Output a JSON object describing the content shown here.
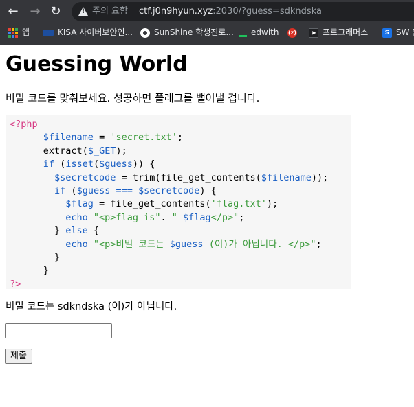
{
  "browser": {
    "security_label": "주의 요함",
    "url_host": "ctf.j0n9hyun.xyz",
    "url_rest": ":2030/?guess=sdkndska",
    "bookmarks": [
      {
        "icon": "apps-grid-icon",
        "label": "앱"
      },
      {
        "icon": "kisa-logo-icon",
        "label": "KISA 사이버보안인..."
      },
      {
        "icon": "sunshine-icon",
        "label": "SunShine 학생진로..."
      },
      {
        "icon": "edwith-icon",
        "label": "edwith"
      },
      {
        "icon": "z-icon",
        "label": ""
      },
      {
        "icon": "programmers-icon",
        "label": "프로그래머스"
      },
      {
        "icon": "sw-icon",
        "label": "SW 단"
      }
    ]
  },
  "page": {
    "title": "Guessing World",
    "description": "비밀 코드를 맞춰보세요. 성공하면 플래그를 뱉어낼 겁니다.",
    "code_lines": [
      {
        "indent": "",
        "parts": [
          {
            "t": "<?php",
            "c": "tag"
          }
        ]
      },
      {
        "indent": "      ",
        "parts": [
          {
            "t": "$filename",
            "c": "var"
          },
          {
            "t": " = ",
            "c": "plain"
          },
          {
            "t": "'secret.txt'",
            "c": "str"
          },
          {
            "t": ";",
            "c": "plain"
          }
        ]
      },
      {
        "indent": "      ",
        "parts": [
          {
            "t": "extract(",
            "c": "plain"
          },
          {
            "t": "$_GET",
            "c": "var"
          },
          {
            "t": ");",
            "c": "plain"
          }
        ]
      },
      {
        "indent": "      ",
        "parts": [
          {
            "t": "if",
            "c": "kw"
          },
          {
            "t": " (",
            "c": "plain"
          },
          {
            "t": "isset",
            "c": "kw"
          },
          {
            "t": "(",
            "c": "plain"
          },
          {
            "t": "$guess",
            "c": "var"
          },
          {
            "t": ")) {",
            "c": "plain"
          }
        ]
      },
      {
        "indent": "        ",
        "parts": [
          {
            "t": "$secretcode",
            "c": "var"
          },
          {
            "t": " = trim(file_get_contents(",
            "c": "plain"
          },
          {
            "t": "$filename",
            "c": "var"
          },
          {
            "t": "));",
            "c": "plain"
          }
        ]
      },
      {
        "indent": "        ",
        "parts": [
          {
            "t": "if",
            "c": "kw"
          },
          {
            "t": " (",
            "c": "plain"
          },
          {
            "t": "$guess",
            "c": "var"
          },
          {
            "t": " === ",
            "c": "kw"
          },
          {
            "t": "$secretcode",
            "c": "var"
          },
          {
            "t": ") {",
            "c": "plain"
          }
        ]
      },
      {
        "indent": "          ",
        "parts": [
          {
            "t": "$flag",
            "c": "var"
          },
          {
            "t": " = file_get_contents(",
            "c": "plain"
          },
          {
            "t": "'flag.txt'",
            "c": "str"
          },
          {
            "t": ");",
            "c": "plain"
          }
        ]
      },
      {
        "indent": "          ",
        "parts": [
          {
            "t": "echo",
            "c": "kw"
          },
          {
            "t": " \"<p>flag is\"",
            "c": "str"
          },
          {
            "t": ". ",
            "c": "plain"
          },
          {
            "t": "\"",
            "c": "str"
          },
          {
            "t": " $flag",
            "c": "var"
          },
          {
            "t": "</p>\"",
            "c": "str"
          },
          {
            "t": ";",
            "c": "plain"
          }
        ]
      },
      {
        "indent": "        ",
        "parts": [
          {
            "t": "} ",
            "c": "plain"
          },
          {
            "t": "else",
            "c": "kw"
          },
          {
            "t": " {",
            "c": "plain"
          }
        ]
      },
      {
        "indent": "          ",
        "parts": [
          {
            "t": "echo",
            "c": "kw"
          },
          {
            "t": " \"<p>비밀 코드는 ",
            "c": "str"
          },
          {
            "t": "$guess",
            "c": "var"
          },
          {
            "t": " (이)가 아닙니다. </p>\"",
            "c": "str"
          },
          {
            "t": ";",
            "c": "plain"
          }
        ]
      },
      {
        "indent": "        ",
        "parts": [
          {
            "t": "}",
            "c": "plain"
          }
        ]
      },
      {
        "indent": "      ",
        "parts": [
          {
            "t": "}",
            "c": "plain"
          }
        ]
      },
      {
        "indent": "",
        "parts": [
          {
            "t": "?>",
            "c": "tag"
          }
        ]
      }
    ],
    "result_text": "비밀 코드는 sdkndska (이)가 아닙니다.",
    "input_value": "",
    "submit_label": "제출"
  },
  "colors": {
    "chrome_bg": "#35363a",
    "code_bg": "#f6f6f6",
    "php_tag": "#d73a84",
    "php_variable": "#1a5fc4",
    "php_string": "#3a9a3a"
  }
}
